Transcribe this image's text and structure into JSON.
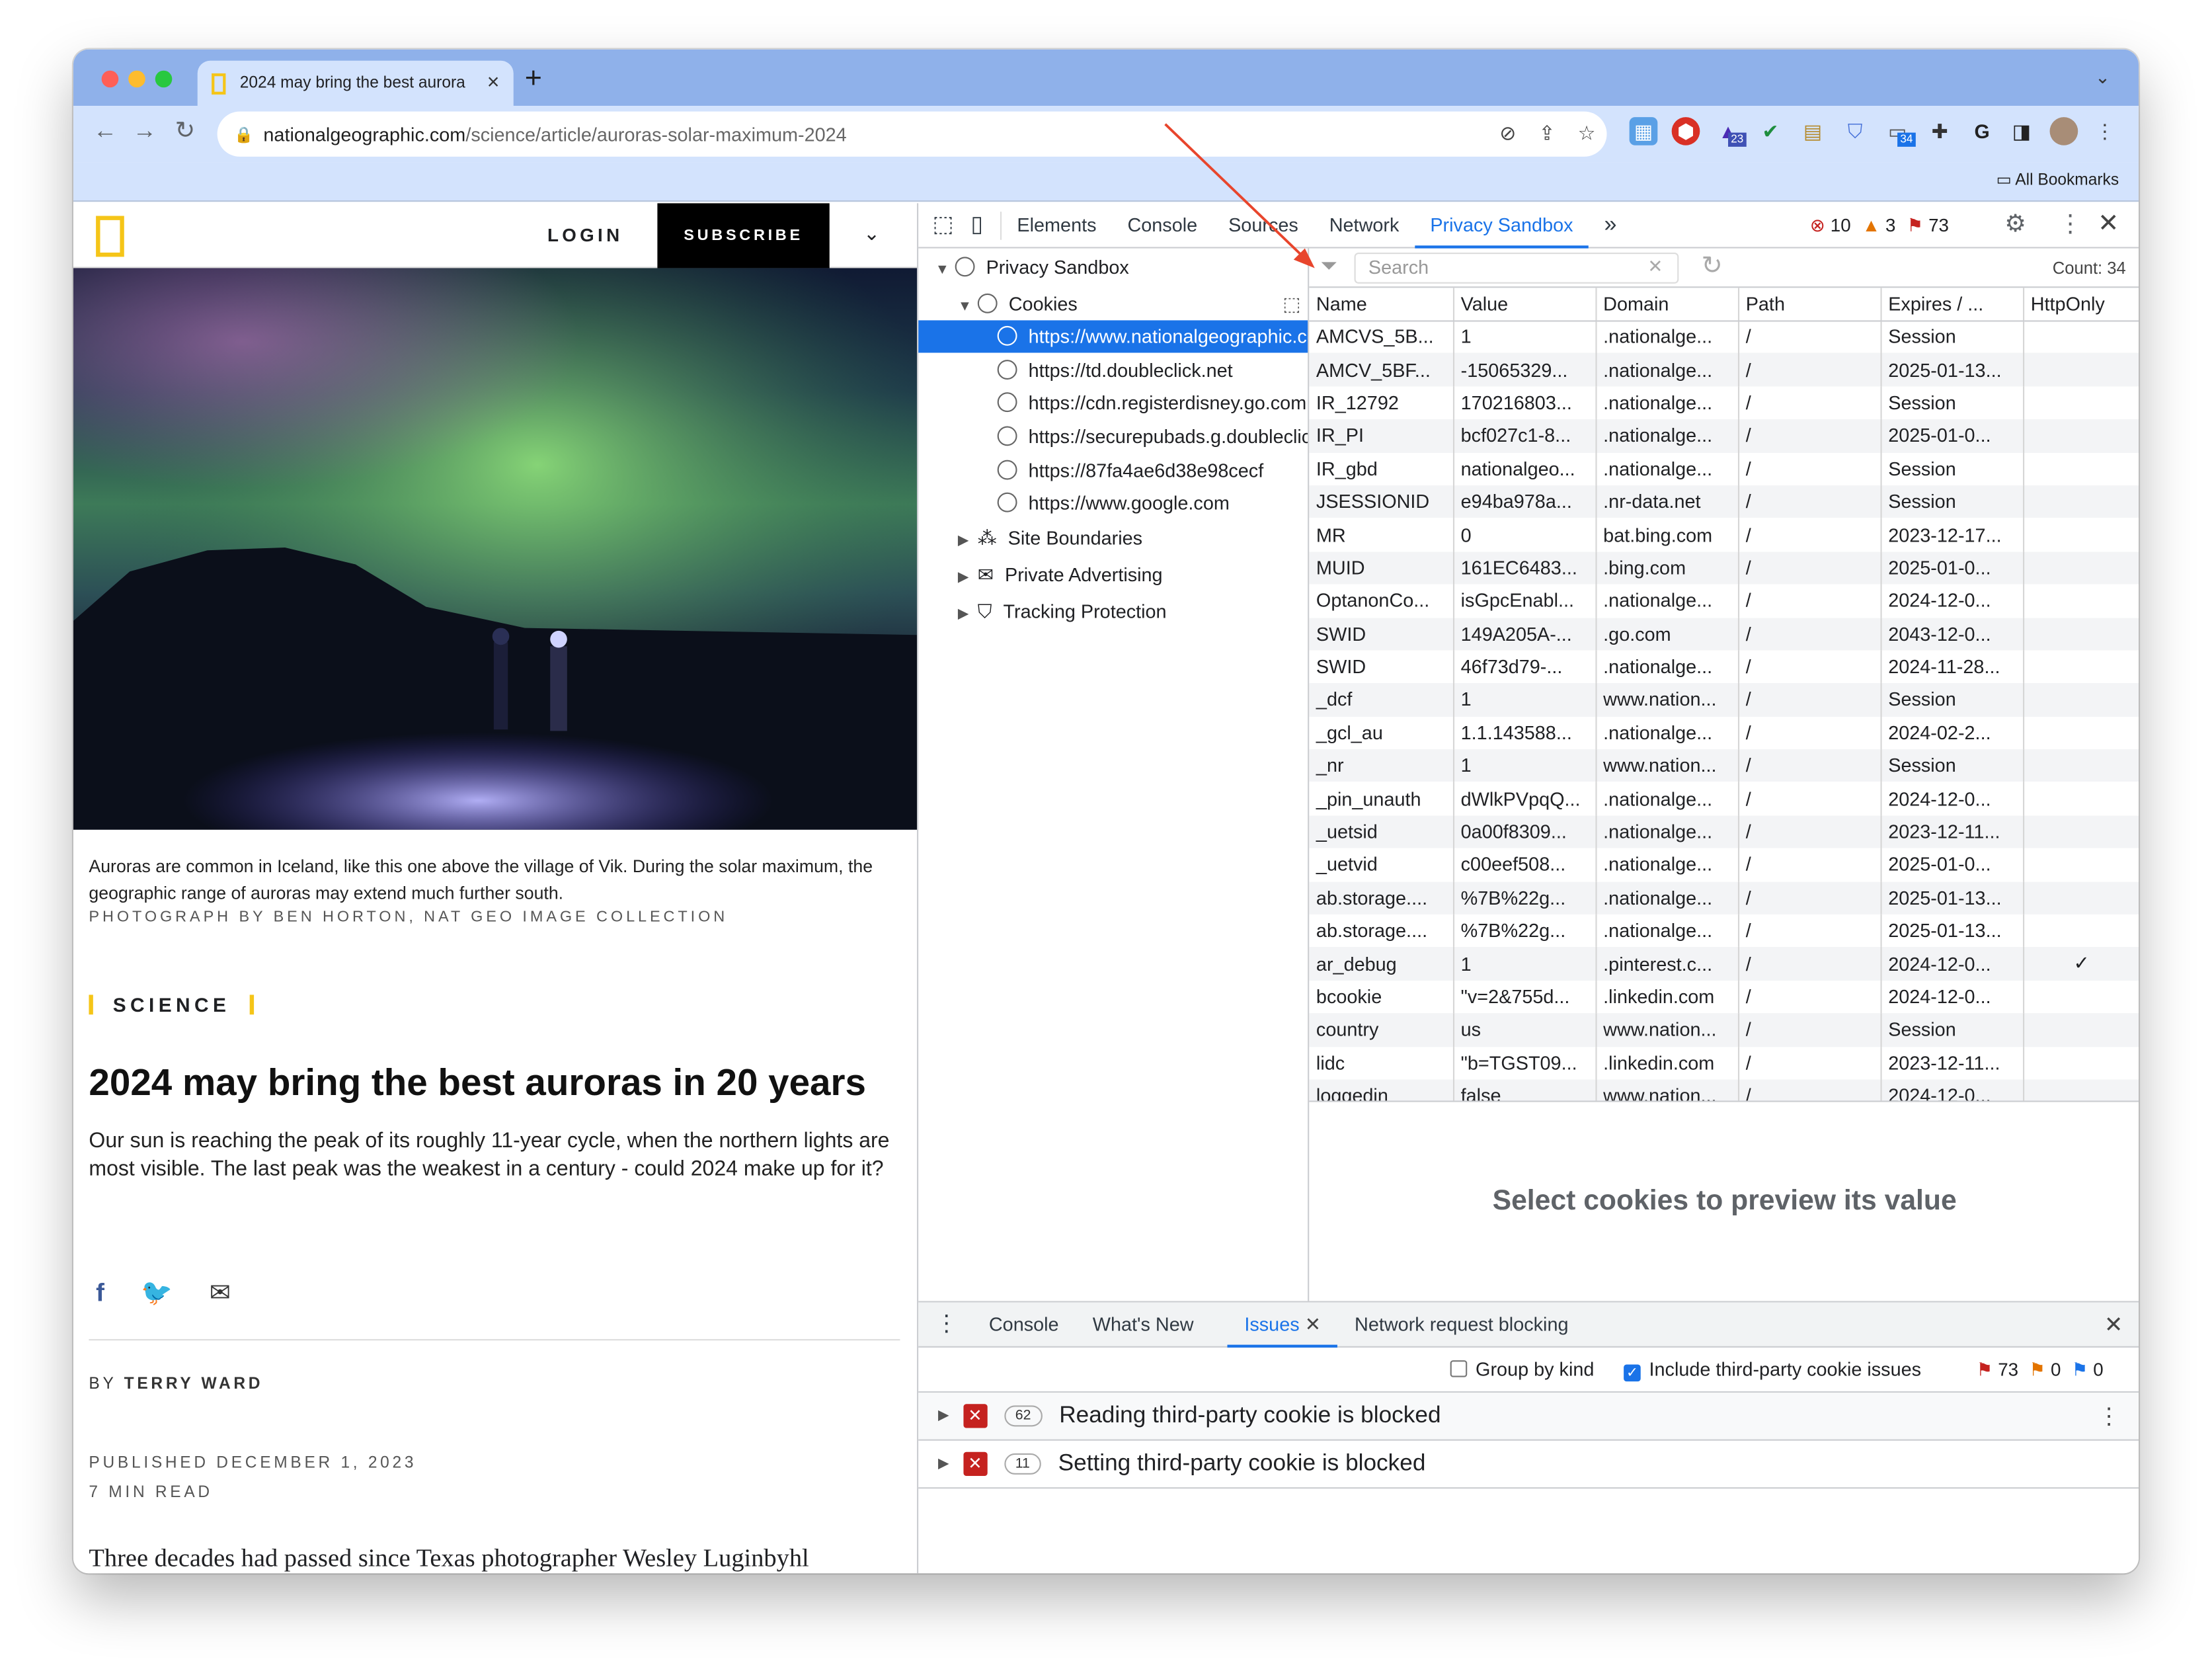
{
  "browser": {
    "tab_title": "2024 may bring the best aurora",
    "url_host": "nationalgeographic.com",
    "url_path": "/science/article/auroras-solar-maximum-2024",
    "bookmarks_label": "All Bookmarks",
    "ext_badge_1": "23",
    "ext_badge_2": "34"
  },
  "article": {
    "login": "LOGIN",
    "subscribe": "SUBSCRIBE",
    "caption": "Auroras are common in Iceland, like this one above the village of Vik. During the solar maximum, the geographic range of auroras may extend much further south.",
    "credit": "PHOTOGRAPH BY BEN HORTON, NAT GEO IMAGE COLLECTION",
    "section": "SCIENCE",
    "headline": "2024 may bring the best auroras in 20 years",
    "dek": "Our sun is reaching the peak of its roughly 11-year cycle, when the northern lights are most visible. The last peak was the weakest in a century - could 2024 make up for it?",
    "byline_prefix": "BY ",
    "author": "TERRY WARD",
    "published": "PUBLISHED DECEMBER 1, 2023",
    "read_time": "7 MIN READ",
    "body_start": "Three decades had passed since Texas photographer Wesley Luginbyhl"
  },
  "devtools": {
    "tabs": [
      "Elements",
      "Console",
      "Sources",
      "Network",
      "Privacy Sandbox"
    ],
    "error_count": "10",
    "warning_count": "3",
    "issue_count": "73",
    "tree": {
      "root": "Privacy Sandbox",
      "cookies": "Cookies",
      "origins": [
        "https://www.nationalgeographic.com",
        "https://td.doubleclick.net",
        "https://cdn.registerdisney.go.com",
        "https://securepubads.g.doubleclick.net",
        "https://87fa4ae6d38e98cecf",
        "https://www.google.com"
      ],
      "site_boundaries": "Site Boundaries",
      "private_advertising": "Private Advertising",
      "tracking_protection": "Tracking Protection"
    },
    "search_placeholder": "Search",
    "count": "Count: 34",
    "columns": [
      "Name",
      "Value",
      "Domain",
      "Path",
      "Expires / ...",
      "HttpOnly"
    ],
    "rows": [
      [
        "AMCVS_5B...",
        "1",
        ".nationalge...",
        "/",
        "Session",
        ""
      ],
      [
        "AMCV_5BF...",
        "-15065329...",
        ".nationalge...",
        "/",
        "2025-01-13...",
        ""
      ],
      [
        "IR_12792",
        "170216803...",
        ".nationalge...",
        "/",
        "Session",
        ""
      ],
      [
        "IR_PI",
        "bcf027c1-8...",
        ".nationalge...",
        "/",
        "2025-01-0...",
        ""
      ],
      [
        "IR_gbd",
        "nationalgeo...",
        ".nationalge...",
        "/",
        "Session",
        ""
      ],
      [
        "JSESSIONID",
        "e94ba978a...",
        ".nr-data.net",
        "/",
        "Session",
        ""
      ],
      [
        "MR",
        "0",
        "bat.bing.com",
        "/",
        "2023-12-17...",
        ""
      ],
      [
        "MUID",
        "161EC6483...",
        ".bing.com",
        "/",
        "2025-01-0...",
        ""
      ],
      [
        "OptanonCo...",
        "isGpcEnabl...",
        ".nationalge...",
        "/",
        "2024-12-0...",
        ""
      ],
      [
        "SWID",
        "149A205A-...",
        ".go.com",
        "/",
        "2043-12-0...",
        ""
      ],
      [
        "SWID",
        "46f73d79-...",
        ".nationalge...",
        "/",
        "2024-11-28...",
        ""
      ],
      [
        "_dcf",
        "1",
        "www.nation...",
        "/",
        "Session",
        ""
      ],
      [
        "_gcl_au",
        "1.1.143588...",
        ".nationalge...",
        "/",
        "2024-02-2...",
        ""
      ],
      [
        "_nr",
        "1",
        "www.nation...",
        "/",
        "Session",
        ""
      ],
      [
        "_pin_unauth",
        "dWlkPVpqQ...",
        ".nationalge...",
        "/",
        "2024-12-0...",
        ""
      ],
      [
        "_uetsid",
        "0a00f8309...",
        ".nationalge...",
        "/",
        "2023-12-11...",
        ""
      ],
      [
        "_uetvid",
        "c00eef508...",
        ".nationalge...",
        "/",
        "2025-01-0...",
        ""
      ],
      [
        "ab.storage....",
        "%7B%22g...",
        ".nationalge...",
        "/",
        "2025-01-13...",
        ""
      ],
      [
        "ab.storage....",
        "%7B%22g...",
        ".nationalge...",
        "/",
        "2025-01-13...",
        ""
      ],
      [
        "ar_debug",
        "1",
        ".pinterest.c...",
        "/",
        "2024-12-0...",
        "✓"
      ],
      [
        "bcookie",
        "\"v=2&755d...",
        ".linkedin.com",
        "/",
        "2024-12-0...",
        ""
      ],
      [
        "country",
        "us",
        "www.nation...",
        "/",
        "Session",
        ""
      ],
      [
        "lidc",
        "\"b=TGST09...",
        ".linkedin.com",
        "/",
        "2023-12-11...",
        ""
      ],
      [
        "loggedin",
        "false",
        "www.nation...",
        "/",
        "2024-12-0...",
        ""
      ]
    ],
    "preview_text": "Select cookies to preview its value",
    "drawer": {
      "tabs": [
        "Console",
        "What's New",
        "Issues",
        "Network request blocking"
      ],
      "group_by_kind": "Group by kind",
      "include_third_party": "Include third-party cookie issues",
      "cnt_errors": "73",
      "cnt_warnings": "0",
      "cnt_info": "0",
      "issues": [
        {
          "count": "62",
          "title": "Reading third-party cookie is blocked"
        },
        {
          "count": "11",
          "title": "Setting third-party cookie is blocked"
        }
      ]
    }
  },
  "colors": {
    "accent": "#1a73e8",
    "natgeo_yellow": "#f5c518",
    "error": "#c5221f",
    "annotation_arrow": "#e8452c"
  }
}
